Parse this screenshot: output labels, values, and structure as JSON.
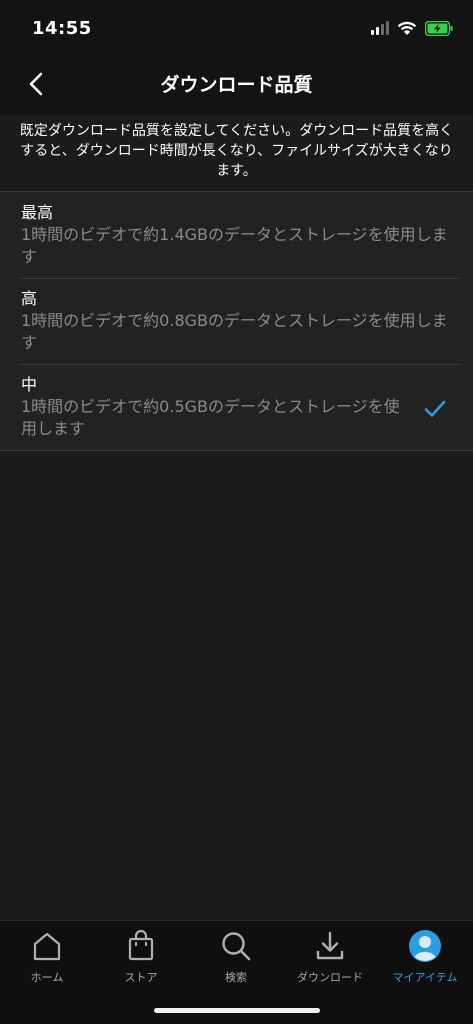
{
  "status_bar": {
    "time": "14:55",
    "icons": [
      "signal-icon",
      "wifi-icon",
      "battery-charging-icon"
    ]
  },
  "header": {
    "back_icon": "chevron-left-icon",
    "title": "ダウンロード品質"
  },
  "description": "既定ダウンロード品質を設定してください。ダウンロード品質を高くすると、ダウンロード時間が長くなり、ファイルサイズが大きくなります。",
  "options": [
    {
      "title": "最高",
      "description": "1時間のビデオで約1.4GBのデータとストレージを使用します",
      "selected": false
    },
    {
      "title": "高",
      "description": "1時間のビデオで約0.8GBのデータとストレージを使用します",
      "selected": false
    },
    {
      "title": "中",
      "description": "1時間のビデオで約0.5GBのデータとストレージを使用します",
      "selected": true
    }
  ],
  "tab_bar": {
    "tabs": [
      {
        "label": "ホーム",
        "icon": "home-icon",
        "active": false
      },
      {
        "label": "ストア",
        "icon": "shopping-bag-icon",
        "active": false
      },
      {
        "label": "検索",
        "icon": "search-icon",
        "active": false
      },
      {
        "label": "ダウンロード",
        "icon": "download-icon",
        "active": false
      },
      {
        "label": "マイアイテム",
        "icon": "avatar-icon",
        "active": true
      }
    ]
  },
  "colors": {
    "background": "#1b1b1b",
    "accent": "#2a9fe0",
    "secondary_text": "#8a8a8a",
    "battery": "#3ad14a"
  }
}
